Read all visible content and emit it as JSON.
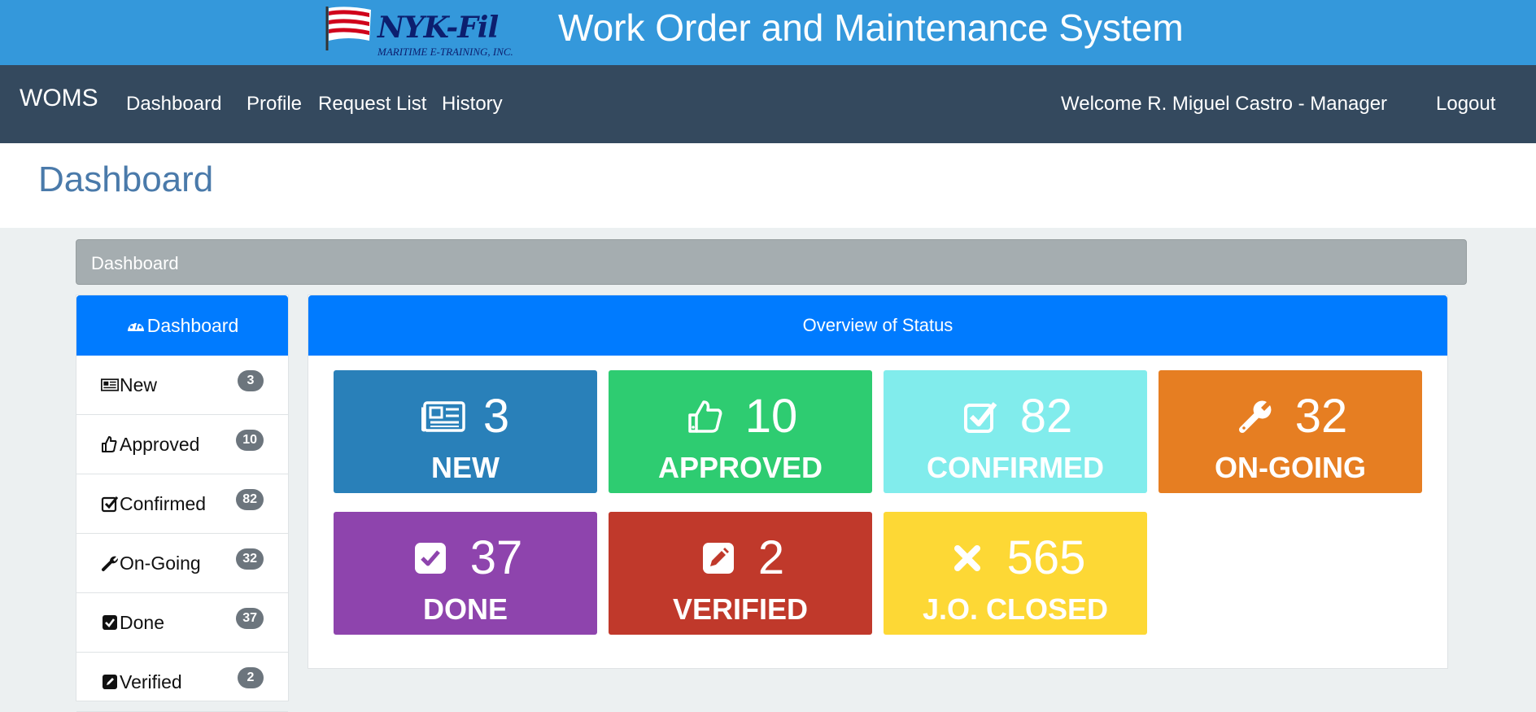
{
  "banner": {
    "logo_text": "NYK-Fil",
    "logo_subtext": "MARITIME E-TRAINING, INC.",
    "system_title": "Work Order and Maintenance System"
  },
  "navbar": {
    "brand": "WOMS",
    "links": [
      "Dashboard",
      "Profile",
      "Request List",
      "History"
    ],
    "welcome": "Welcome R. Miguel Castro - Manager",
    "logout": "Logout"
  },
  "page": {
    "title": "Dashboard",
    "breadcrumb": "Dashboard"
  },
  "sidebar": {
    "header": {
      "label": "Dashboard",
      "icon": "dashboard-icon"
    },
    "items": [
      {
        "label": "New",
        "count": "3",
        "icon": "newspaper-icon"
      },
      {
        "label": "Approved",
        "count": "10",
        "icon": "thumbs-up-icon"
      },
      {
        "label": "Confirmed",
        "count": "82",
        "icon": "check-square-icon"
      },
      {
        "label": "On-Going",
        "count": "32",
        "icon": "wrench-icon"
      },
      {
        "label": "Done",
        "count": "37",
        "icon": "check-square-filled-icon"
      },
      {
        "label": "Verified",
        "count": "2",
        "icon": "pencil-square-icon"
      }
    ]
  },
  "overview": {
    "title": "Overview of Status",
    "tiles": [
      {
        "label": "NEW",
        "count": "3",
        "color": "#2980b9",
        "icon": "newspaper-icon"
      },
      {
        "label": "APPROVED",
        "count": "10",
        "color": "#2ecc71",
        "icon": "thumbs-up-icon"
      },
      {
        "label": "CONFIRMED",
        "count": "82",
        "color": "#81ecec",
        "icon": "check-square-icon"
      },
      {
        "label": "ON-GOING",
        "count": "32",
        "color": "#e67e22",
        "icon": "wrench-icon"
      },
      {
        "label": "DONE",
        "count": "37",
        "color": "#8e44ad",
        "icon": "check-square-filled-icon"
      },
      {
        "label": "VERIFIED",
        "count": "2",
        "color": "#c0392b",
        "icon": "pencil-square-icon"
      },
      {
        "label": "J.O. CLOSED",
        "count": "565",
        "color": "#fdd835",
        "icon": "times-icon"
      }
    ]
  },
  "colors": {
    "banner": "#3498db",
    "navbar": "#34495e",
    "primary": "#007bff",
    "badge": "#6c757d"
  }
}
